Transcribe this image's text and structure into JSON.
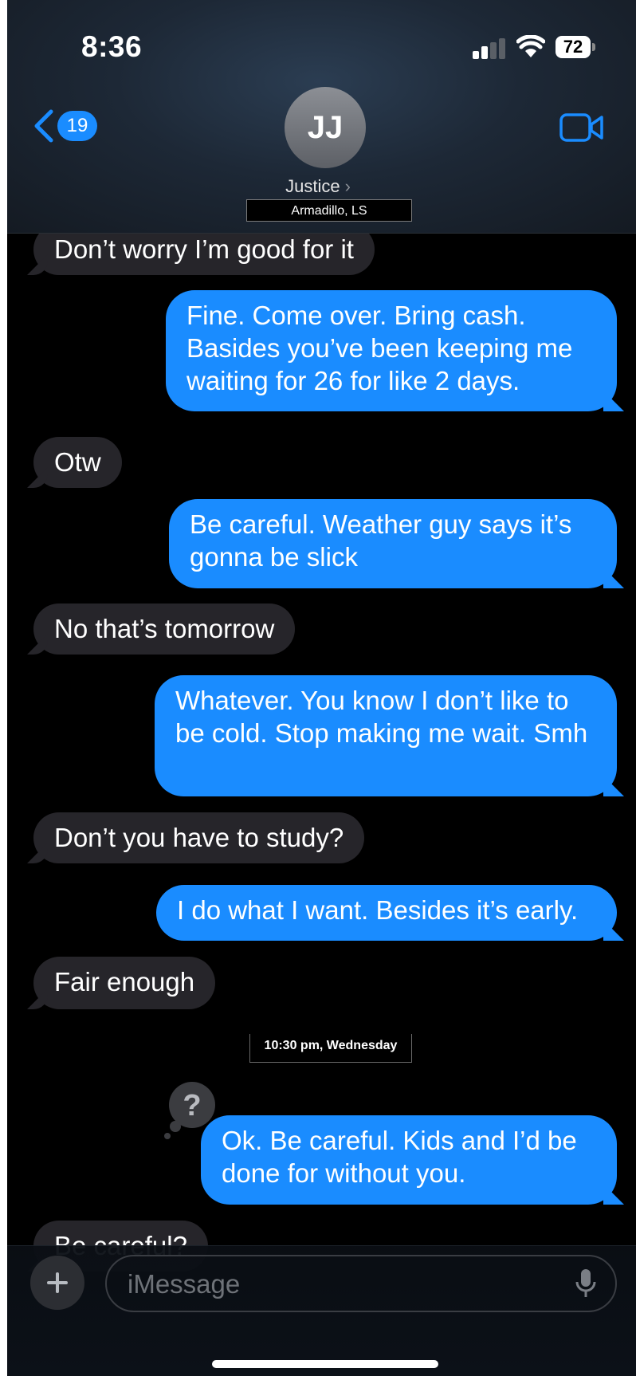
{
  "status_bar": {
    "time": "8:36",
    "battery": "72"
  },
  "header": {
    "back_count": "19",
    "avatar_initials": "JJ",
    "contact_name": "Justice",
    "location": "Armadillo, LS"
  },
  "messages": [
    {
      "from": "them",
      "text": "Don’t worry I’m good for it"
    },
    {
      "from": "me",
      "text": "Fine. Come over. Bring cash. Basides you’ve been keeping me waiting for 26 for like 2 days."
    },
    {
      "from": "them",
      "text": "Otw"
    },
    {
      "from": "me",
      "text": "Be careful. Weather guy says it’s gonna be slick"
    },
    {
      "from": "them",
      "text": "No that’s tomorrow"
    },
    {
      "from": "me",
      "text": "Whatever. You know I don’t like to be cold. Stop making me wait. Smh"
    },
    {
      "from": "them",
      "text": "Don’t you have to study?"
    },
    {
      "from": "me",
      "text": "I do what I want. Besides it’s early."
    },
    {
      "from": "them",
      "text": "Fair enough"
    },
    {
      "from": "me",
      "text": "Ok. Be careful. Kids and I’d be done for without you."
    },
    {
      "from": "them",
      "text": "Be careful?"
    }
  ],
  "timestamp": "10:30 pm, Wednesday",
  "composer": {
    "placeholder": "iMessage"
  },
  "colors": {
    "sent_bubble": "#1a8cff",
    "received_bubble": "#26252a",
    "background": "#000000"
  },
  "icons": [
    "back-chevron-icon",
    "video-camera-icon",
    "question-mark-icon",
    "plus-icon",
    "microphone-icon",
    "signal-icon",
    "wifi-icon",
    "battery-icon"
  ]
}
